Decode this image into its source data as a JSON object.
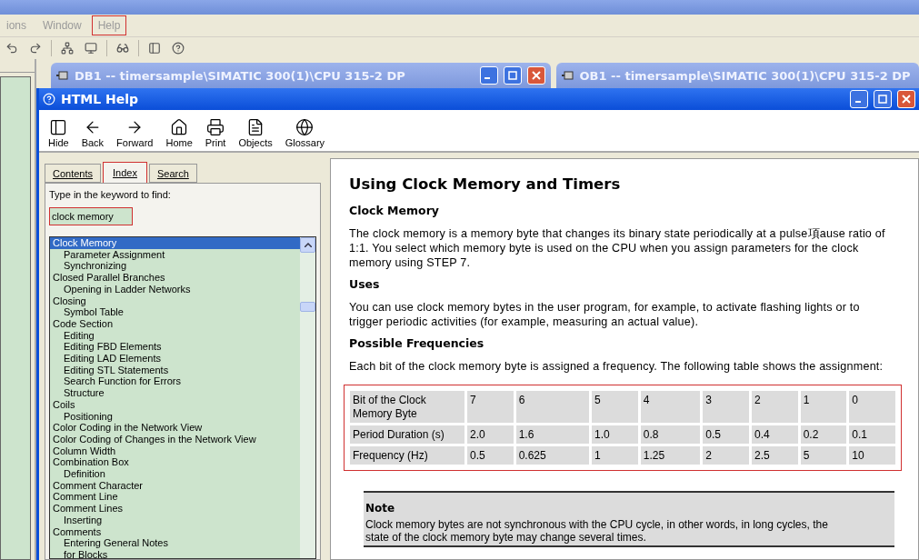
{
  "menu": [
    {
      "label": "ions",
      "highlighted": false
    },
    {
      "label": "Window",
      "highlighted": false
    },
    {
      "label": "Help",
      "highlighted": true
    }
  ],
  "mdi_windows": [
    {
      "title": "DB1 -- timersample\\SIMATIC 300(1)\\CPU 315-2 DP",
      "controls": true
    },
    {
      "title": "OB1 -- timersample\\SIMATIC 300(1)\\CPU 315-2 DP",
      "controls": false
    }
  ],
  "help_window": {
    "title": "HTML Help",
    "toolbar": [
      "Hide",
      "Back",
      "Forward",
      "Home",
      "Print",
      "Objects",
      "Glossary"
    ],
    "tabs": [
      {
        "label": "Contents",
        "selected": false,
        "highlighted": false
      },
      {
        "label": "Index",
        "selected": true,
        "highlighted": true
      },
      {
        "label": "Search",
        "selected": false,
        "highlighted": false
      }
    ],
    "prompt": "Type in the keyword to find:",
    "keyword": {
      "value": "clock memory",
      "highlighted": true
    },
    "index": [
      {
        "label": "Clock Memory",
        "selected": true,
        "children": [
          {
            "label": "Parameter Assignment",
            "selected": false
          },
          {
            "label": "Synchronizing",
            "selected": false
          }
        ]
      },
      {
        "label": "Closed Parallel Branches",
        "selected": false,
        "children": [
          {
            "label": "Opening in Ladder Networks",
            "selected": false
          }
        ]
      },
      {
        "label": "Closing",
        "selected": false,
        "children": [
          {
            "label": "Symbol Table",
            "selected": false
          }
        ]
      },
      {
        "label": "Code Section",
        "selected": false,
        "children": [
          {
            "label": "Editing",
            "selected": false
          },
          {
            "label": "Editing FBD Elements",
            "selected": false
          },
          {
            "label": "Editing LAD Elements",
            "selected": false
          },
          {
            "label": "Editing STL Statements",
            "selected": false
          },
          {
            "label": "Search Function for Errors",
            "selected": false
          },
          {
            "label": "Structure",
            "selected": false
          }
        ]
      },
      {
        "label": "Coils",
        "selected": false,
        "children": [
          {
            "label": "Positioning",
            "selected": false
          }
        ]
      },
      {
        "label": "Color Coding in the Network View",
        "selected": false
      },
      {
        "label": "Color Coding of Changes in the Network View",
        "selected": false
      },
      {
        "label": "Column Width",
        "selected": false
      },
      {
        "label": "Combination Box",
        "selected": false,
        "children": [
          {
            "label": "Definition",
            "selected": false
          }
        ]
      },
      {
        "label": "Comment Character",
        "selected": false
      },
      {
        "label": "Comment Line",
        "selected": false
      },
      {
        "label": "Comment Lines",
        "selected": false,
        "children": [
          {
            "label": "Inserting",
            "selected": false
          }
        ]
      },
      {
        "label": "Comments",
        "selected": false,
        "children": [
          {
            "label": "Entering General Notes",
            "selected": false
          },
          {
            "label": "for Blocks",
            "selected": false
          }
        ]
      }
    ],
    "article": {
      "title": "Using Clock Memory and Timers",
      "sections": [
        {
          "heading": "Clock Memory",
          "text": "The clock memory is a memory byte that changes its binary state periodically at a pulse項ause ratio of 1:1. You select which memory byte is used on the CPU when you assign parameters for the clock memory using STEP 7."
        },
        {
          "heading": "Uses",
          "text": "You can use clock memory bytes in the user program, for example, to activate flashing lights or to trigger periodic activities (for example, measuring an actual value)."
        },
        {
          "heading": "Possible Frequencies",
          "text": "Each bit of the clock memory byte is assigned a frequency. The following table shows the assignment:"
        }
      ],
      "table": {
        "highlighted": true,
        "rows": [
          {
            "header": "Bit of the Clock Memory Byte",
            "cells": [
              "7",
              "6",
              "5",
              "4",
              "3",
              "2",
              "1",
              "0"
            ]
          },
          {
            "header": "Period Duration (s)",
            "cells": [
              "2.0",
              "1.6",
              "1.0",
              "0.8",
              "0.5",
              "0.4",
              "0.2",
              "0.1"
            ]
          },
          {
            "header": "Frequency (Hz)",
            "cells": [
              "0.5",
              "0.625",
              "1",
              "1.25",
              "2",
              "2.5",
              "5",
              "10"
            ]
          }
        ]
      },
      "note": {
        "title": "Note",
        "text": "Clock memory bytes are not synchronous with the CPU cycle, in other words, in long cycles, the state of the clock memory byte may change several times."
      }
    }
  }
}
